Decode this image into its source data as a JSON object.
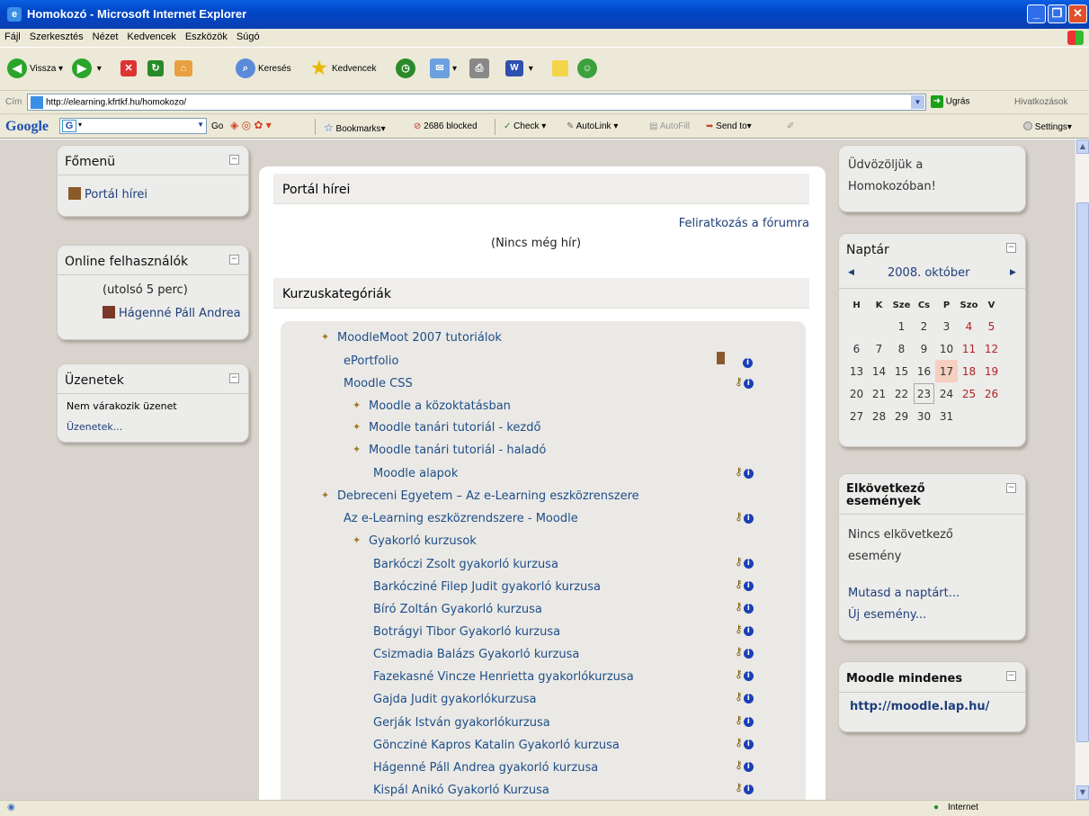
{
  "window": {
    "title": "Homokozó - Microsoft Internet Explorer"
  },
  "menu": [
    "Fájl",
    "Szerkesztés",
    "Nézet",
    "Kedvencek",
    "Eszközök",
    "Súgó"
  ],
  "toolbar": {
    "back": "Vissza",
    "search": "Keresés",
    "favorites": "Kedvencek"
  },
  "address": {
    "label": "Cím",
    "url": "http://elearning.kfrtkf.hu/homokozo/",
    "go": "Ugrás",
    "links": "Hivatkozások"
  },
  "google": {
    "logo": "Google",
    "go": "Go",
    "bookmarks": "Bookmarks",
    "blocked": "2686 blocked",
    "check": "Check",
    "autolink": "AutoLink",
    "autofill": "AutoFill",
    "sendto": "Send to",
    "settings": "Settings"
  },
  "status": {
    "zone": "Internet"
  },
  "left": {
    "mainmenu": {
      "title": "Főmenü",
      "item": "Portál hírei"
    },
    "online": {
      "title": "Online felhasználók",
      "period": "(utolsó 5 perc)",
      "user": "Hágenné Páll Andrea"
    },
    "messages": {
      "title": "Üzenetek",
      "none": "Nem várakozik üzenet",
      "link": "Üzenetek..."
    }
  },
  "center": {
    "news": {
      "title": "Portál hírei",
      "subscribe": "Feliratkozás a fórumra",
      "empty": "(Nincs még hír)"
    },
    "categories": {
      "title": "Kurzuskategóriák",
      "items": [
        {
          "label": "MoodleMoot 2007 tutoriálok",
          "type": "category"
        },
        {
          "label": "ePortfolio",
          "type": "course"
        },
        {
          "label": "Moodle CSS",
          "type": "course"
        },
        {
          "label": "Moodle a közoktatásban",
          "type": "category"
        },
        {
          "label": "Moodle tanári tutoriál - kezdő",
          "type": "category"
        },
        {
          "label": "Moodle tanári tutoriál - haladó",
          "type": "category"
        },
        {
          "label": "Moodle alapok",
          "type": "course"
        },
        {
          "label": "Debreceni Egyetem – Az e-Learning eszközrenszere",
          "type": "category"
        },
        {
          "label": "Az e-Learning eszközrendszere - Moodle",
          "type": "course"
        },
        {
          "label": "Gyakorló kurzusok",
          "type": "category"
        },
        {
          "label": "Barkóczi Zsolt gyakorló kurzusa",
          "type": "course"
        },
        {
          "label": "Barkócziné Filep Judit gyakorló kurzusa",
          "type": "course"
        },
        {
          "label": "Bíró Zoltán Gyakorló kurzusa",
          "type": "course"
        },
        {
          "label": "Botrágyi Tibor Gyakorló kurzusa",
          "type": "course"
        },
        {
          "label": "Csizmadia Balázs Gyakorló kurzusa",
          "type": "course"
        },
        {
          "label": "Fazekasné Vincze Henrietta gyakorlókurzusa",
          "type": "course"
        },
        {
          "label": "Gajda Judit gyakorlókurzusa",
          "type": "course"
        },
        {
          "label": "Gerják István gyakorlókurzusa",
          "type": "course"
        },
        {
          "label": "Gönczinė Kapros Katalin Gyakorló kurzusa",
          "type": "course"
        },
        {
          "label": "Hágenné Páll Andrea gyakorló kurzusa",
          "type": "course"
        },
        {
          "label": "Kispál Anikó Gyakorló Kurzusa",
          "type": "course"
        }
      ]
    }
  },
  "right": {
    "welcome": {
      "line1": "Üdvözöljük a",
      "line2": "Homokozóban!"
    },
    "calendar": {
      "title": "Naptár",
      "month": "2008. október",
      "days": [
        "H",
        "K",
        "Sze",
        "Cs",
        "P",
        "Szo",
        "V"
      ],
      "weeks": [
        [
          "",
          "",
          "1",
          "2",
          "3",
          "4",
          "5"
        ],
        [
          "6",
          "7",
          "8",
          "9",
          "10",
          "11",
          "12"
        ],
        [
          "13",
          "14",
          "15",
          "16",
          "17",
          "18",
          "19"
        ],
        [
          "20",
          "21",
          "22",
          "23",
          "24",
          "25",
          "26"
        ],
        [
          "27",
          "28",
          "29",
          "30",
          "31",
          "",
          ""
        ]
      ],
      "today": "17",
      "selected": "23",
      "weekend_color": "#b22222",
      "today_color": "#f5cfc0"
    },
    "upcoming": {
      "title1": "Elkövetkező",
      "title2": "események",
      "none1": "Nincs elkövetkező",
      "none2": "esemény",
      "link1": "Mutasd a naptárt...",
      "link2": "Új esemény..."
    },
    "moodle": {
      "title": "Moodle mindenes",
      "link": "http://moodle.lap.hu/"
    }
  }
}
